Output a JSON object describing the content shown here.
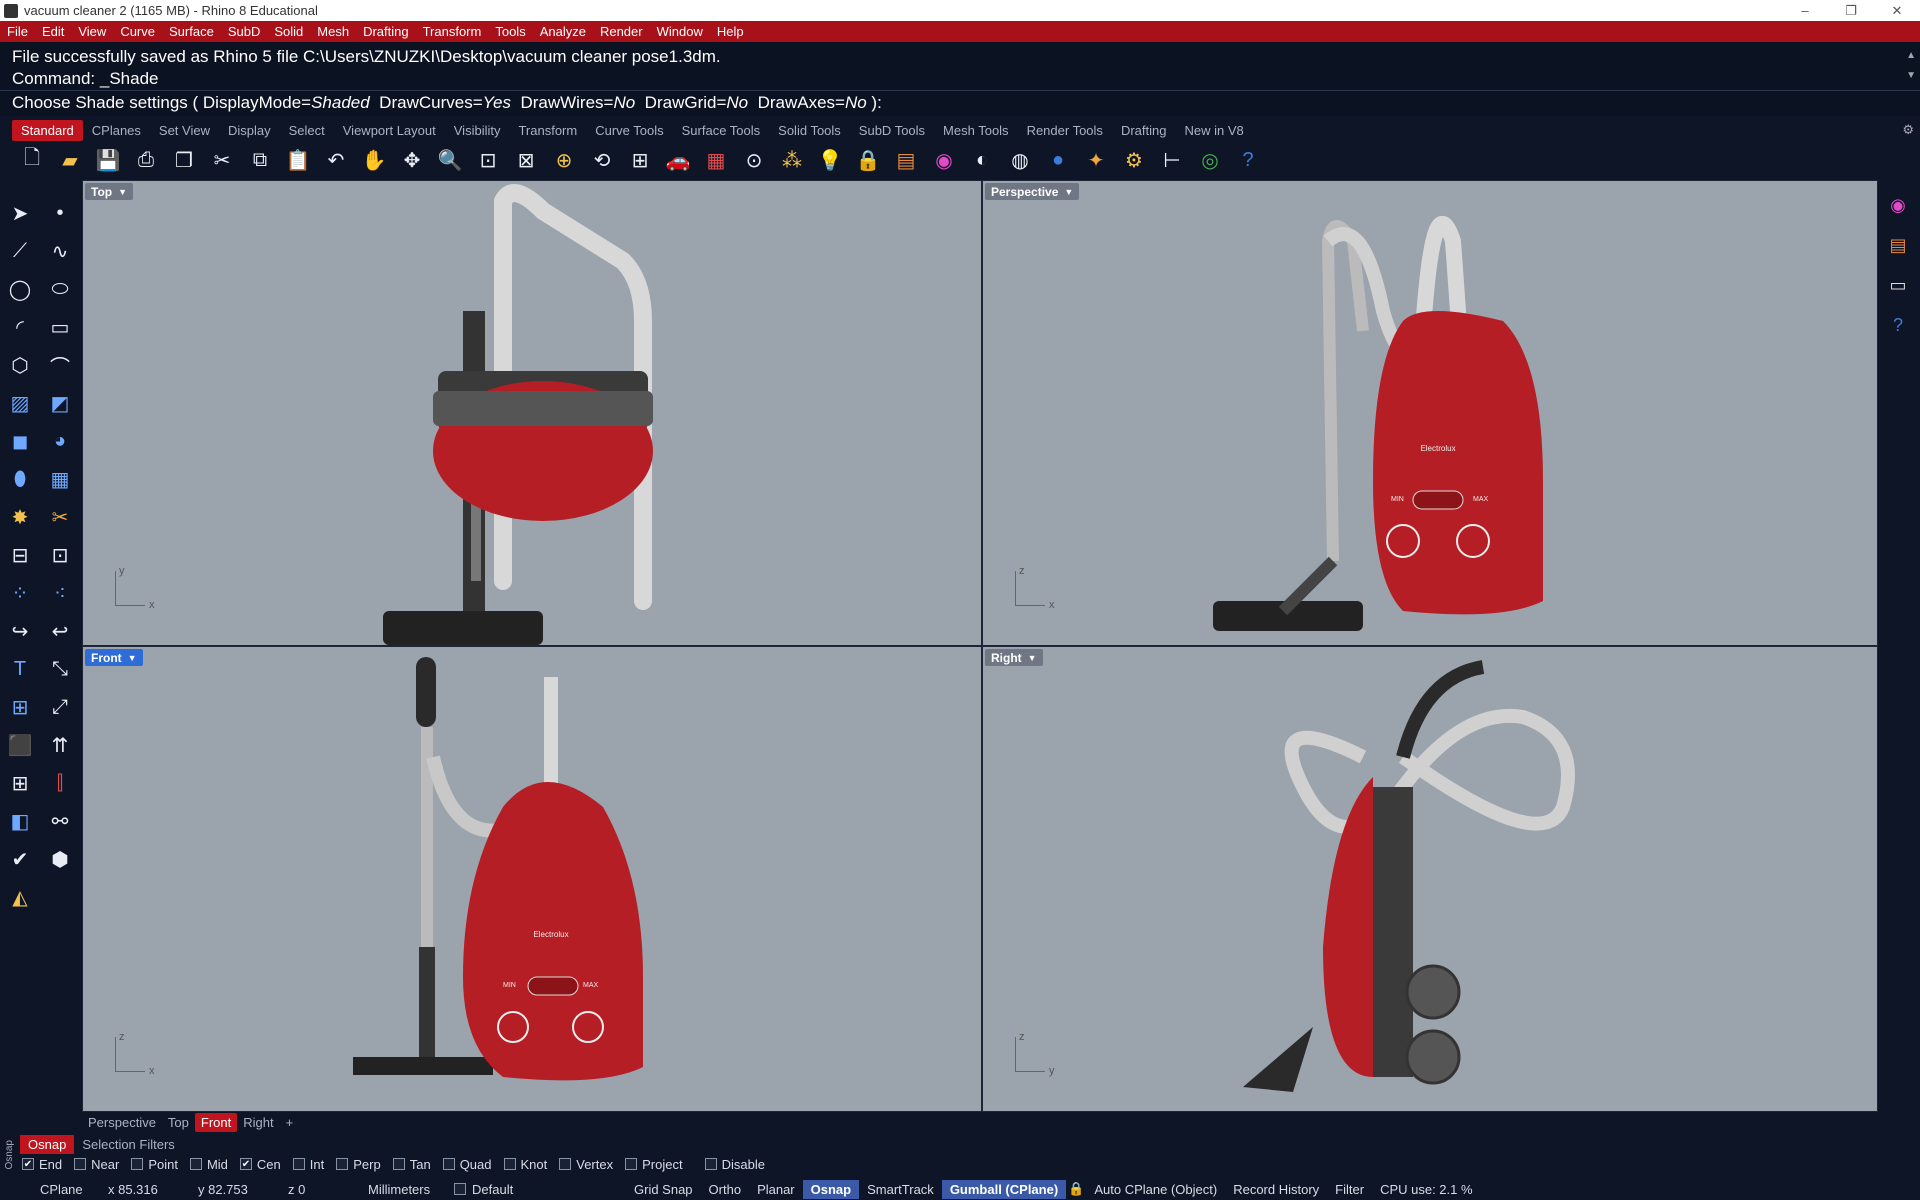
{
  "window": {
    "title": "vacuum cleaner 2 (1165 MB) - Rhino 8 Educational",
    "controls": [
      "–",
      "❐",
      "✕"
    ]
  },
  "menu": [
    "File",
    "Edit",
    "View",
    "Curve",
    "Surface",
    "SubD",
    "Solid",
    "Mesh",
    "Drafting",
    "Transform",
    "Tools",
    "Analyze",
    "Render",
    "Window",
    "Help"
  ],
  "command": {
    "history_line1": "File successfully saved as Rhino 5 file C:\\Users\\ZNUZKI\\Desktop\\vacuum cleaner pose1.3dm.",
    "history_line2": "Command: _Shade",
    "prompt_prefix": "Choose Shade settings ( DisplayMode=",
    "display_mode": "Shaded",
    "draw_curves_label": "DrawCurves=",
    "draw_curves": "Yes",
    "draw_wires_label": "DrawWires=",
    "draw_wires": "No",
    "draw_grid_label": "DrawGrid=",
    "draw_grid": "No",
    "draw_axes_label": "DrawAxes=",
    "draw_axes": "No",
    "prompt_suffix": " ):"
  },
  "toolbar_tabs": [
    "Standard",
    "CPlanes",
    "Set View",
    "Display",
    "Select",
    "Viewport Layout",
    "Visibility",
    "Transform",
    "Curve Tools",
    "Surface Tools",
    "Solid Tools",
    "SubD Tools",
    "Mesh Tools",
    "Render Tools",
    "Drafting",
    "New in V8"
  ],
  "viewports": {
    "top": {
      "label": "Top",
      "axis_v": "y",
      "axis_h": "x"
    },
    "perspective": {
      "label": "Perspective",
      "axis_v": "z",
      "axis_h": "x"
    },
    "front": {
      "label": "Front",
      "axis_v": "z",
      "axis_h": "x"
    },
    "right": {
      "label": "Right",
      "axis_v": "z",
      "axis_h": "y"
    }
  },
  "model_text": {
    "brand": "Electrolux",
    "min": "MIN",
    "max": "MAX"
  },
  "viewport_tabs": [
    "Perspective",
    "Top",
    "Front",
    "Right"
  ],
  "viewport_tab_add": "+",
  "osnap_tabs": [
    "Osnap",
    "Selection Filters"
  ],
  "osnap_side_label": "Osnap",
  "osnap_options": [
    {
      "label": "End",
      "checked": true
    },
    {
      "label": "Near",
      "checked": false
    },
    {
      "label": "Point",
      "checked": false
    },
    {
      "label": "Mid",
      "checked": false
    },
    {
      "label": "Cen",
      "checked": true
    },
    {
      "label": "Int",
      "checked": false
    },
    {
      "label": "Perp",
      "checked": false
    },
    {
      "label": "Tan",
      "checked": false
    },
    {
      "label": "Quad",
      "checked": false
    },
    {
      "label": "Knot",
      "checked": false
    },
    {
      "label": "Vertex",
      "checked": false
    },
    {
      "label": "Project",
      "checked": false
    },
    {
      "label": "Disable",
      "checked": false
    }
  ],
  "status": {
    "cplane": "CPlane",
    "x": "x 85.316",
    "y": "y 82.753",
    "z": "z 0",
    "units": "Millimeters",
    "layer": "Default",
    "grid_snap": "Grid Snap",
    "ortho": "Ortho",
    "planar": "Planar",
    "osnap": "Osnap",
    "smarttrack": "SmartTrack",
    "gumball": "Gumball (CPlane)",
    "auto_cplane": "Auto CPlane (Object)",
    "record_history": "Record History",
    "filter": "Filter",
    "cpu": "CPU use: 2.1 %"
  },
  "colors": {
    "accent": "#c0141f",
    "viewport_bg": "#9ba3ad",
    "body_red": "#b51e24"
  }
}
